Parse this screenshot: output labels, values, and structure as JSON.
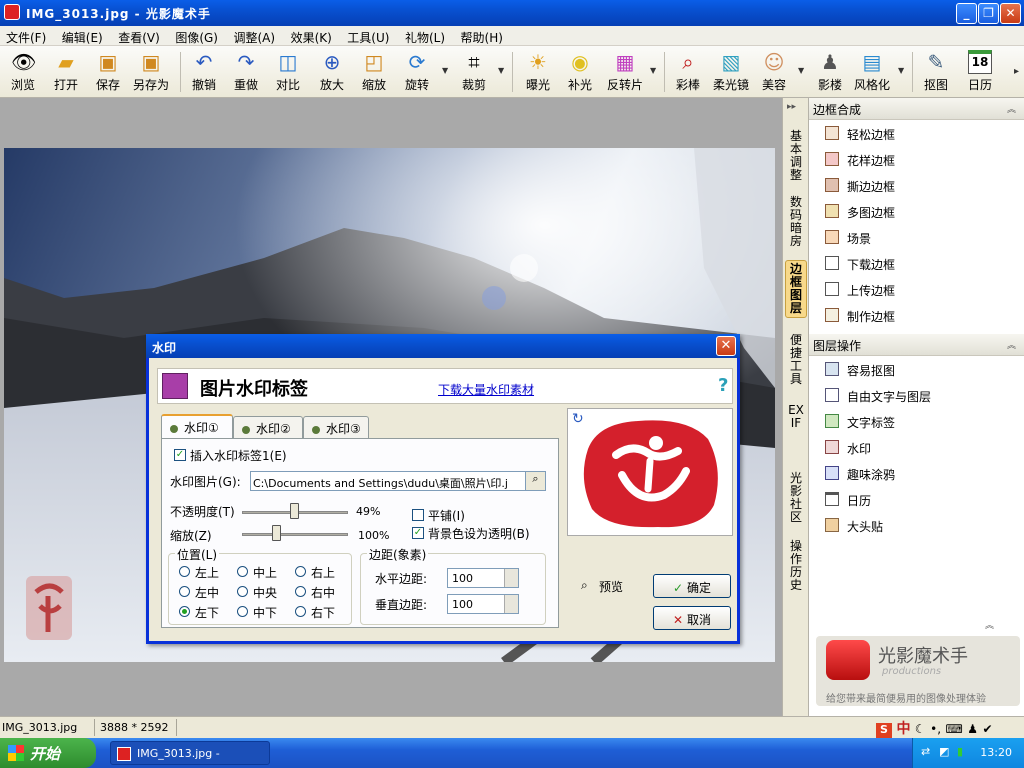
{
  "window": {
    "title": "IMG_3013.jpg - 光影魔术手"
  },
  "menu": [
    "文件(F)",
    "编辑(E)",
    "查看(V)",
    "图像(G)",
    "调整(A)",
    "效果(K)",
    "工具(U)",
    "礼物(L)",
    "帮助(H)"
  ],
  "toolbar": [
    "浏览",
    "打开",
    "保存",
    "另存为",
    "撤销",
    "重做",
    "对比",
    "放大",
    "缩放",
    "旋转",
    "裁剪",
    "曝光",
    "补光",
    "反转片",
    "彩棒",
    "柔光镜",
    "美容",
    "影楼",
    "风格化",
    "抠图",
    "日历"
  ],
  "calendar_day": "18",
  "side_tabs": [
    "基本调整",
    "数码暗房",
    "边框图层",
    "便捷工具",
    "EXIF",
    "光影社区",
    "操作历史"
  ],
  "panel": {
    "section1": "边框合成",
    "section1_items": [
      "轻松边框",
      "花样边框",
      "撕边边框",
      "多图边框",
      "场景",
      "下载边框",
      "上传边框",
      "制作边框"
    ],
    "section2": "图层操作",
    "section2_items": [
      "容易抠图",
      "自由文字与图层",
      "文字标签",
      "水印",
      "趣味涂鸦",
      "日历",
      "大头贴"
    ]
  },
  "brand": {
    "name": "光影魔术手",
    "sub": "productions",
    "slogan": "给您带来最简便易用的图像处理体验"
  },
  "dialog": {
    "title": "水印",
    "heading": "图片水印标签",
    "download_link": "下载大量水印素材",
    "help": "?",
    "tabs": [
      "水印①",
      "水印②",
      "水印③"
    ],
    "insert_label": "插入水印标签1(E)",
    "image_label": "水印图片(G):",
    "image_path": "C:\\Documents and Settings\\dudu\\桌面\\照片\\印.j",
    "opacity_label": "不透明度(T)",
    "opacity_value": "49%",
    "opacity": 0.49,
    "scale_label": "缩放(Z)",
    "scale_value": "100%",
    "tile_label": "平铺(I)",
    "tile_checked": false,
    "transparent_bg_label": "背景色设为透明(B)",
    "transparent_bg_checked": true,
    "position_label": "位置(L)",
    "positions": [
      "左上",
      "中上",
      "右上",
      "左中",
      "中央",
      "右中",
      "左下",
      "中下",
      "右下"
    ],
    "position_selected": "左下",
    "margin_label": "边距(象素)",
    "h_margin_label": "水平边距:",
    "h_margin": "100",
    "v_margin_label": "垂直边距:",
    "v_margin": "100",
    "preview_label": "预览",
    "ok_label": "确定",
    "cancel_label": "取消"
  },
  "status": {
    "filename": "IMG_3013.jpg",
    "dimensions": "3888 * 2592"
  },
  "taskbar": {
    "start": "开始",
    "item": "IMG_3013.jpg -",
    "clock": "13:20",
    "ime": "中"
  }
}
